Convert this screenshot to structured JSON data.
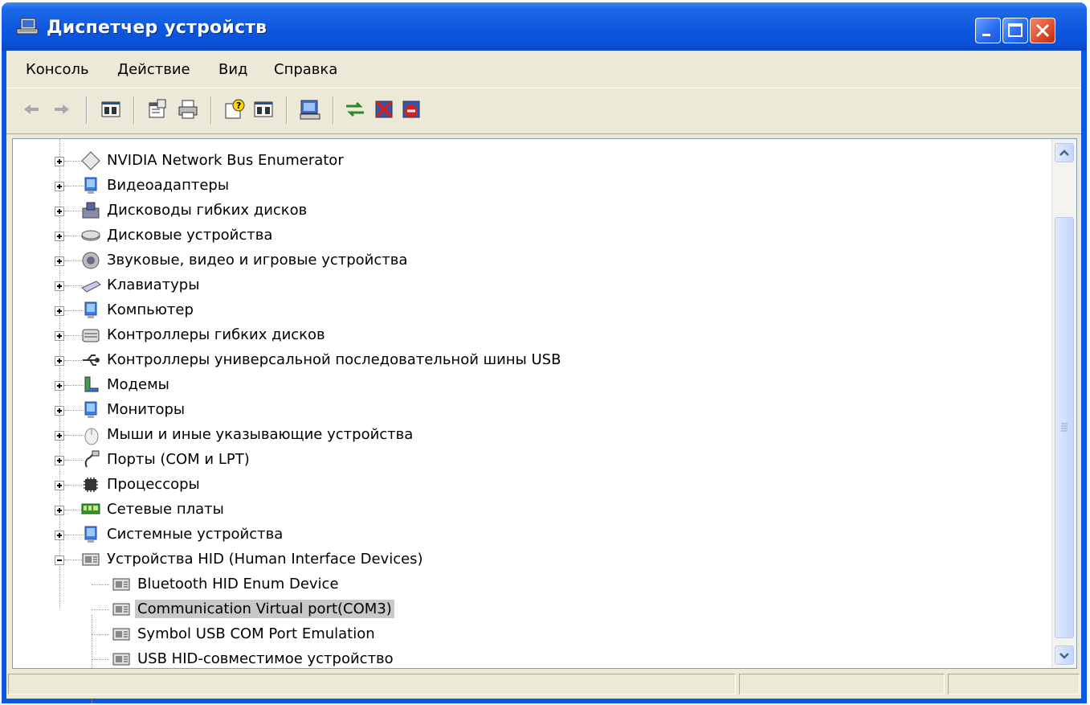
{
  "window": {
    "title": "Диспетчер устройств",
    "title_bar_color": "#0a58e0"
  },
  "menu": {
    "items": [
      "Консоль",
      "Действие",
      "Вид",
      "Справка"
    ]
  },
  "toolbar": {
    "icons": [
      "back-arrow-icon",
      "forward-arrow-icon",
      "show-hide-console-tree-icon",
      "properties-icon",
      "print-icon",
      "help-icon",
      "action-pane-icon",
      "scan-hardware-icon",
      "update-driver-icon",
      "disable-device-icon",
      "uninstall-device-icon"
    ]
  },
  "tree": {
    "categories": [
      {
        "label": "NVIDIA Network Bus Enumerator",
        "icon": "diamond-icon",
        "expanded": false
      },
      {
        "label": "Видеоадаптеры",
        "icon": "display-adapter-icon",
        "expanded": false
      },
      {
        "label": "Дисководы гибких дисков",
        "icon": "floppy-drive-icon",
        "expanded": false
      },
      {
        "label": "Дисковые устройства",
        "icon": "disk-drive-icon",
        "expanded": false
      },
      {
        "label": "Звуковые, видео и игровые устройства",
        "icon": "sound-icon",
        "expanded": false
      },
      {
        "label": "Клавиатуры",
        "icon": "keyboard-icon",
        "expanded": false
      },
      {
        "label": "Компьютер",
        "icon": "computer-icon",
        "expanded": false
      },
      {
        "label": "Контроллеры гибких дисков",
        "icon": "floppy-controller-icon",
        "expanded": false
      },
      {
        "label": "Контроллеры универсальной последовательной шины USB",
        "icon": "usb-icon",
        "expanded": false
      },
      {
        "label": "Модемы",
        "icon": "modem-icon",
        "expanded": false
      },
      {
        "label": "Мониторы",
        "icon": "monitor-icon",
        "expanded": false
      },
      {
        "label": "Мыши и иные указывающие устройства",
        "icon": "mouse-icon",
        "expanded": false
      },
      {
        "label": "Порты (COM и LPT)",
        "icon": "port-icon",
        "expanded": false
      },
      {
        "label": "Процессоры",
        "icon": "processor-icon",
        "expanded": false
      },
      {
        "label": "Сетевые платы",
        "icon": "network-card-icon",
        "expanded": false
      },
      {
        "label": "Системные устройства",
        "icon": "system-device-icon",
        "expanded": false
      },
      {
        "label": "Устройства HID (Human Interface Devices)",
        "icon": "hid-icon",
        "expanded": true
      }
    ],
    "hid_children": [
      {
        "label": "Bluetooth HID Enum Device",
        "selected": false
      },
      {
        "label": "Communication Virtual port(COM3)",
        "selected": true
      },
      {
        "label": "Symbol USB COM Port Emulation",
        "selected": false
      },
      {
        "label": "USB HID-совместимое устройство",
        "selected": false
      }
    ]
  }
}
